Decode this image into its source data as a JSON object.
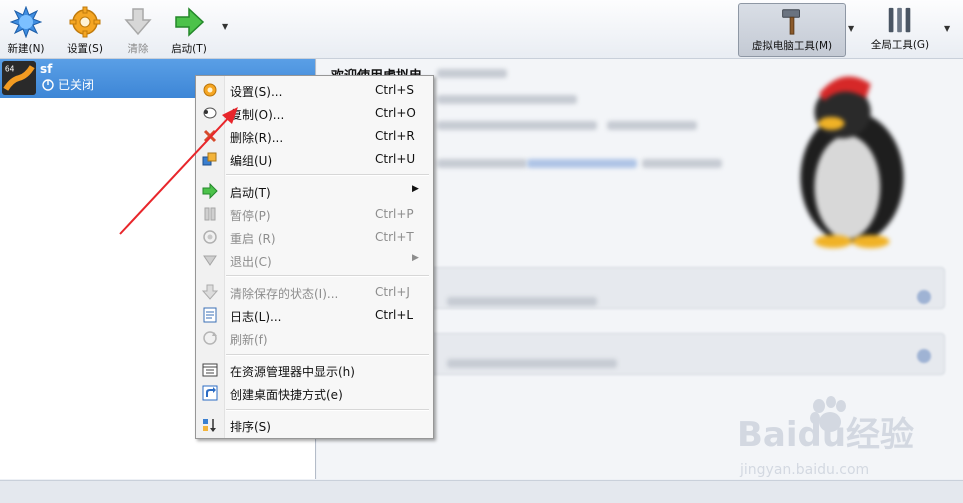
{
  "toolbar": {
    "new_label": "新建(N)",
    "settings_label": "设置(S)",
    "discard_label": "清除",
    "start_label": "启动(T)",
    "machine_tools_label": "虚拟电脑工具(M)",
    "global_tools_label": "全局工具(G)"
  },
  "vm_list": {
    "items": [
      {
        "name": "sf",
        "state": "已关闭",
        "badge": "64"
      }
    ]
  },
  "detail": {
    "welcome_title": "欢迎使用虚拟电"
  },
  "context_menu": {
    "items": [
      {
        "label": "设置(S)...",
        "shortcut": "Ctrl+S",
        "icon": "settings-gear-icon",
        "enabled": true
      },
      {
        "label": "复制(O)...",
        "shortcut": "Ctrl+O",
        "icon": "clone-sheep-icon",
        "enabled": true
      },
      {
        "label": "删除(R)...",
        "shortcut": "Ctrl+R",
        "icon": "remove-x-icon",
        "enabled": true
      },
      {
        "label": "编组(U)",
        "shortcut": "Ctrl+U",
        "icon": "group-icon",
        "enabled": true
      },
      {
        "label": "启动(T)",
        "shortcut": "",
        "icon": "start-arrow-icon",
        "enabled": true,
        "submenu": true
      },
      {
        "label": "暂停(P)",
        "shortcut": "Ctrl+P",
        "icon": "pause-icon",
        "enabled": false
      },
      {
        "label": "重启 (R)",
        "shortcut": "Ctrl+T",
        "icon": "reset-icon",
        "enabled": false
      },
      {
        "label": "退出(C)",
        "shortcut": "",
        "icon": "close-triangle-icon",
        "enabled": false,
        "submenu": true
      },
      {
        "label": "清除保存的状态(I)...",
        "shortcut": "Ctrl+J",
        "icon": "discard-state-icon",
        "enabled": false
      },
      {
        "label": "日志(L)...",
        "shortcut": "Ctrl+L",
        "icon": "log-icon",
        "enabled": true
      },
      {
        "label": "刷新(f)",
        "shortcut": "",
        "icon": "refresh-icon",
        "enabled": false
      },
      {
        "label": "在资源管理器中显示(h)",
        "shortcut": "",
        "icon": "explorer-icon",
        "enabled": true
      },
      {
        "label": "创建桌面快捷方式(e)",
        "shortcut": "",
        "icon": "shortcut-icon",
        "enabled": true
      },
      {
        "label": "排序(S)",
        "shortcut": "",
        "icon": "sort-icon",
        "enabled": true
      }
    ]
  },
  "watermark": {
    "brand": "Baidu经验",
    "url": "jingyan.baidu.com"
  },
  "colors": {
    "selection": "#3d86d6",
    "arrow_annotation": "#e8262b"
  }
}
